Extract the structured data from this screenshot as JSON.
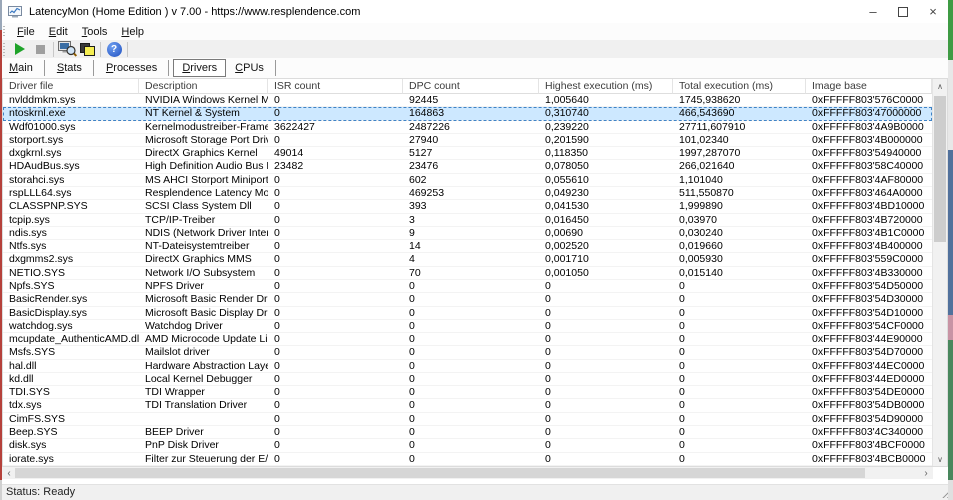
{
  "window": {
    "title": "LatencyMon  (Home Edition )  v 7.00 - https://www.resplendence.com",
    "controls": {
      "minimize": "–",
      "close": "×"
    }
  },
  "menu": {
    "items": [
      {
        "label": "File"
      },
      {
        "label": "Edit"
      },
      {
        "label": "Tools"
      },
      {
        "label": "Help"
      }
    ]
  },
  "toolbar": {
    "help_glyph": "?"
  },
  "tabs": {
    "items": [
      "Main",
      "Stats",
      "Processes",
      "Drivers",
      "CPUs"
    ],
    "selected": "Drivers"
  },
  "table": {
    "columns": [
      "Driver file",
      "Description",
      "ISR count",
      "DPC count",
      "Highest execution (ms)",
      "Total execution (ms)",
      "Image base"
    ],
    "selected_index": 1,
    "rows": [
      {
        "file": "nvlddmkm.sys",
        "description": "NVIDIA Windows Kernel Mod...",
        "isr": "0",
        "dpc": "92445",
        "highest": "1,005640",
        "total": "1745,938620",
        "base": "0xFFFFF803'576C0000"
      },
      {
        "file": "ntoskrnl.exe",
        "description": "NT Kernel & System",
        "isr": "0",
        "dpc": "164863",
        "highest": "0,310740",
        "total": "466,543690",
        "base": "0xFFFFF803'47000000"
      },
      {
        "file": "Wdf01000.sys",
        "description": "Kernelmodustreiber-Framewor...",
        "isr": "3622427",
        "dpc": "2487226",
        "highest": "0,239220",
        "total": "27711,607910",
        "base": "0xFFFFF803'4A9B0000"
      },
      {
        "file": "storport.sys",
        "description": "Microsoft Storage Port Driver",
        "isr": "0",
        "dpc": "27940",
        "highest": "0,201590",
        "total": "101,02340",
        "base": "0xFFFFF803'4B000000"
      },
      {
        "file": "dxgkrnl.sys",
        "description": "DirectX Graphics Kernel",
        "isr": "49014",
        "dpc": "5127",
        "highest": "0,118350",
        "total": "1997,287070",
        "base": "0xFFFFF803'54940000"
      },
      {
        "file": "HDAudBus.sys",
        "description": "High Definition Audio Bus Driver",
        "isr": "23482",
        "dpc": "23476",
        "highest": "0,078050",
        "total": "266,021640",
        "base": "0xFFFFF803'58C40000"
      },
      {
        "file": "storahci.sys",
        "description": "MS AHCI Storport Miniport Dri...",
        "isr": "0",
        "dpc": "602",
        "highest": "0,055610",
        "total": "1,101040",
        "base": "0xFFFFF803'4AF80000"
      },
      {
        "file": "rspLLL64.sys",
        "description": "Resplendence Latency Monit...",
        "isr": "0",
        "dpc": "469253",
        "highest": "0,049230",
        "total": "511,550870",
        "base": "0xFFFFF803'464A0000"
      },
      {
        "file": "CLASSPNP.SYS",
        "description": "SCSI Class System Dll",
        "isr": "0",
        "dpc": "393",
        "highest": "0,041530",
        "total": "1,999890",
        "base": "0xFFFFF803'4BD10000"
      },
      {
        "file": "tcpip.sys",
        "description": "TCP/IP-Treiber",
        "isr": "0",
        "dpc": "3",
        "highest": "0,016450",
        "total": "0,03970",
        "base": "0xFFFFF803'4B720000"
      },
      {
        "file": "ndis.sys",
        "description": "NDIS (Network Driver Interface...",
        "isr": "0",
        "dpc": "9",
        "highest": "0,00690",
        "total": "0,030240",
        "base": "0xFFFFF803'4B1C0000"
      },
      {
        "file": "Ntfs.sys",
        "description": "NT-Dateisystemtreiber",
        "isr": "0",
        "dpc": "14",
        "highest": "0,002520",
        "total": "0,019660",
        "base": "0xFFFFF803'4B400000"
      },
      {
        "file": "dxgmms2.sys",
        "description": "DirectX Graphics MMS",
        "isr": "0",
        "dpc": "4",
        "highest": "0,001710",
        "total": "0,005930",
        "base": "0xFFFFF803'559C0000"
      },
      {
        "file": "NETIO.SYS",
        "description": "Network I/O Subsystem",
        "isr": "0",
        "dpc": "70",
        "highest": "0,001050",
        "total": "0,015140",
        "base": "0xFFFFF803'4B330000"
      },
      {
        "file": "Npfs.SYS",
        "description": "NPFS Driver",
        "isr": "0",
        "dpc": "0",
        "highest": "0",
        "total": "0",
        "base": "0xFFFFF803'54D50000"
      },
      {
        "file": "BasicRender.sys",
        "description": "Microsoft Basic Render Driver",
        "isr": "0",
        "dpc": "0",
        "highest": "0",
        "total": "0",
        "base": "0xFFFFF803'54D30000"
      },
      {
        "file": "BasicDisplay.sys",
        "description": "Microsoft Basic Display Driver",
        "isr": "0",
        "dpc": "0",
        "highest": "0",
        "total": "0",
        "base": "0xFFFFF803'54D10000"
      },
      {
        "file": "watchdog.sys",
        "description": "Watchdog Driver",
        "isr": "0",
        "dpc": "0",
        "highest": "0",
        "total": "0",
        "base": "0xFFFFF803'54CF0000"
      },
      {
        "file": "mcupdate_AuthenticAMD.dll",
        "description": "AMD Microcode Update Library",
        "isr": "0",
        "dpc": "0",
        "highest": "0",
        "total": "0",
        "base": "0xFFFFF803'44E90000"
      },
      {
        "file": "Msfs.SYS",
        "description": "Mailslot driver",
        "isr": "0",
        "dpc": "0",
        "highest": "0",
        "total": "0",
        "base": "0xFFFFF803'54D70000"
      },
      {
        "file": "hal.dll",
        "description": "Hardware Abstraction Layer DLL",
        "isr": "0",
        "dpc": "0",
        "highest": "0",
        "total": "0",
        "base": "0xFFFFF803'44EC0000"
      },
      {
        "file": "kd.dll",
        "description": "Local Kernel Debugger",
        "isr": "0",
        "dpc": "0",
        "highest": "0",
        "total": "0",
        "base": "0xFFFFF803'44ED0000"
      },
      {
        "file": "TDI.SYS",
        "description": "TDI Wrapper",
        "isr": "0",
        "dpc": "0",
        "highest": "0",
        "total": "0",
        "base": "0xFFFFF803'54DE0000"
      },
      {
        "file": "tdx.sys",
        "description": "TDI Translation Driver",
        "isr": "0",
        "dpc": "0",
        "highest": "0",
        "total": "0",
        "base": "0xFFFFF803'54DB0000"
      },
      {
        "file": "CimFS.SYS",
        "description": "",
        "isr": "0",
        "dpc": "0",
        "highest": "0",
        "total": "0",
        "base": "0xFFFFF803'54D90000"
      },
      {
        "file": "Beep.SYS",
        "description": "BEEP Driver",
        "isr": "0",
        "dpc": "0",
        "highest": "0",
        "total": "0",
        "base": "0xFFFFF803'4C340000"
      },
      {
        "file": "disk.sys",
        "description": "PnP Disk Driver",
        "isr": "0",
        "dpc": "0",
        "highest": "0",
        "total": "0",
        "base": "0xFFFFF803'4BCF0000"
      },
      {
        "file": "iorate.sys",
        "description": "Filter zur Steuerung der E/A-...",
        "isr": "0",
        "dpc": "0",
        "highest": "0",
        "total": "0",
        "base": "0xFFFFF803'4BCB0000"
      }
    ]
  },
  "scrollbars": {
    "up": "∧",
    "down": "∨",
    "left": "‹",
    "right": "›"
  },
  "status_bar": {
    "text": "Status: Ready"
  },
  "colors": {
    "selection_bg": "#cde8ff",
    "selection_border": "#3f83c6",
    "play_green": "#1fa32a",
    "help_blue": "#1e4fc0",
    "stack_icon_yellow": "#f5ee53"
  }
}
